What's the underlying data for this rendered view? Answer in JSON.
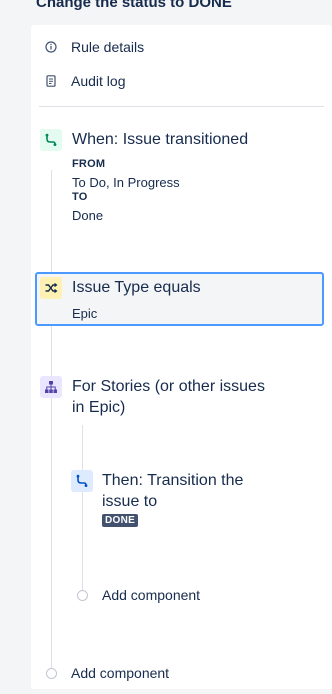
{
  "header": {
    "title": "Change the status to DONE"
  },
  "menu": [
    {
      "label": "Rule details",
      "icon": "info-icon"
    },
    {
      "label": "Audit log",
      "icon": "document-icon"
    }
  ],
  "trigger": {
    "title": "When: Issue transitioned",
    "from_label": "FROM",
    "from_value": "To Do, In Progress",
    "to_label": "TO",
    "to_value": "Done"
  },
  "condition": {
    "title": "Issue Type equals",
    "value": "Epic"
  },
  "branch": {
    "title_line1": "For Stories (or other issues",
    "title_line2": "in Epic)"
  },
  "action": {
    "title_line1": "Then: Transition the",
    "title_line2": "issue to",
    "status": "DONE"
  },
  "add_component_inner": "Add component",
  "add_component_outer": "Add component",
  "colors": {
    "selection_border": "#4c9aff",
    "trigger_bg": "#e3fcef",
    "condition_bg": "#fff0b3",
    "branch_bg": "#eae6ff",
    "action_bg": "#deebff",
    "lozenge_bg": "#42526e"
  }
}
